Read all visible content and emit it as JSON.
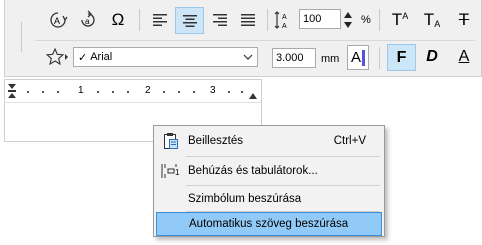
{
  "toolbar": {
    "row1_buttons": [
      {
        "name": "rotate-text-icon"
      },
      {
        "name": "rotate-text-alt-icon"
      },
      {
        "name": "omega-symbol-icon"
      },
      {
        "name": "align-left-icon"
      },
      {
        "name": "align-center-icon"
      },
      {
        "name": "align-right-icon"
      },
      {
        "name": "justify-icon"
      }
    ],
    "line_spacing_value": "100",
    "line_spacing_unit": "%",
    "superscript": "T",
    "superscript_a": "A",
    "subscript": "T",
    "subscript_a": "A",
    "strikethrough": "T",
    "font_name": "Arial",
    "font_check": "✓",
    "font_size": "3.000",
    "font_unit": "mm",
    "color_letter": "A",
    "bold": "F",
    "italic": "D",
    "underline": "A"
  },
  "ruler": {
    "numbers": [
      "1",
      "2",
      "3"
    ]
  },
  "context_menu": {
    "items": [
      {
        "label": "Beillesztés",
        "shortcut": "Ctrl+V"
      },
      {
        "label": "Behúzás és tabulátorok...",
        "shortcut": ""
      },
      {
        "label": "Szimbólum beszúrása",
        "shortcut": ""
      },
      {
        "label": "Automatikus szöveg beszúrása",
        "shortcut": ""
      }
    ]
  }
}
